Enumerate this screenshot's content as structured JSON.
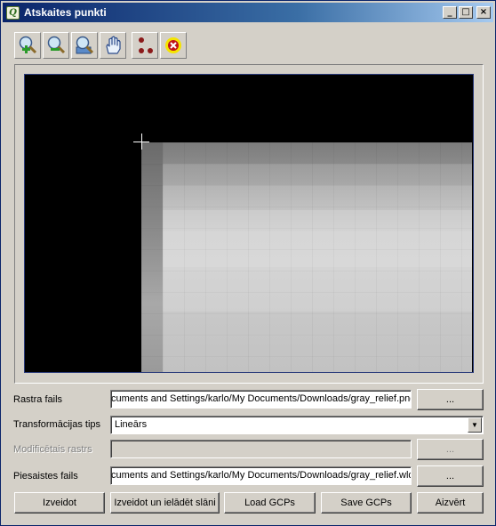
{
  "window": {
    "title": "Atskaites punkti",
    "minimize_glyph": "_",
    "maximize_glyph": "□",
    "close_glyph": "×",
    "app_icon_glyph": "Q"
  },
  "toolbar": {
    "tools": [
      {
        "name": "zoom-in-icon"
      },
      {
        "name": "zoom-out-icon"
      },
      {
        "name": "zoom-to-layer-icon"
      },
      {
        "name": "pan-icon"
      },
      {
        "name": "add-point-icon"
      },
      {
        "name": "delete-point-icon"
      }
    ]
  },
  "form": {
    "raster_label": "Rastra fails",
    "raster_value": "cuments and Settings/karlo/My Documents/Downloads/gray_relief.png",
    "transform_label": "Transformācijas tips",
    "transform_value": "Lineārs",
    "modified_label": "Modificētais rastrs",
    "modified_value": "",
    "world_label": "Piesaistes fails",
    "world_value": "cuments and Settings/karlo/My Documents/Downloads/gray_relief.wld",
    "browse_label": "..."
  },
  "buttons": {
    "create": "Izveidot",
    "create_load": "Izveidot un ielādēt slāni",
    "load_gcps": "Load GCPs",
    "save_gcps": "Save GCPs",
    "close": "Aizvērt"
  },
  "colors": {
    "titlebar_start": "#0a246a",
    "titlebar_end": "#a6caf0",
    "face": "#d4d0c8",
    "point_color": "#8b1a1a",
    "delete_ring": "#f5e400"
  }
}
